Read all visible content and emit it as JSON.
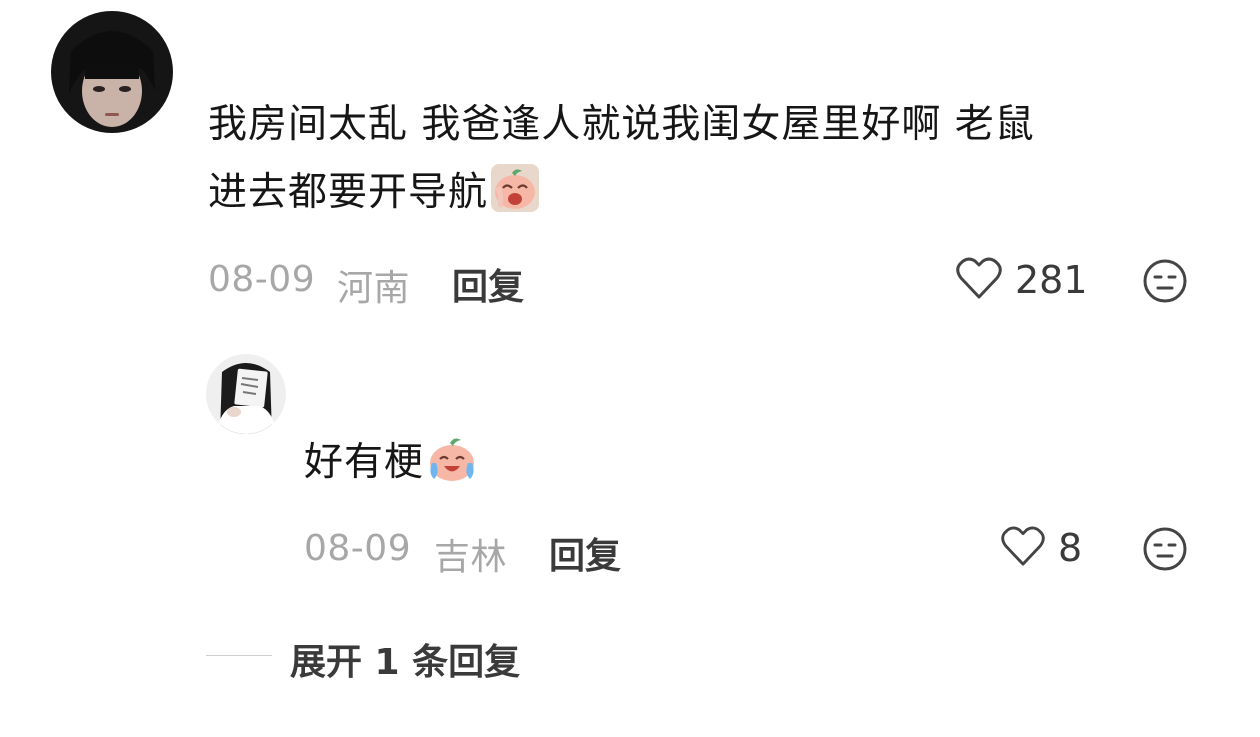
{
  "comment": {
    "text_line1": "我房间太乱 我爸逢人就说我闺女屋里好啊 老鼠",
    "text_line2": "进去都要开导航",
    "emoji": "crying-peach-emoji",
    "date": "08-09",
    "location": "河南",
    "reply_label": "回复",
    "likes": "281"
  },
  "reply": {
    "text": "好有梗",
    "emoji": "laughing-crying-peach-emoji",
    "date": "08-09",
    "location": "吉林",
    "reply_label": "回复",
    "likes": "8"
  },
  "expand": {
    "label": "展开 1 条回复"
  },
  "colors": {
    "text": "#161616",
    "meta": "#a7a7a7",
    "action": "#3a3a3a"
  }
}
